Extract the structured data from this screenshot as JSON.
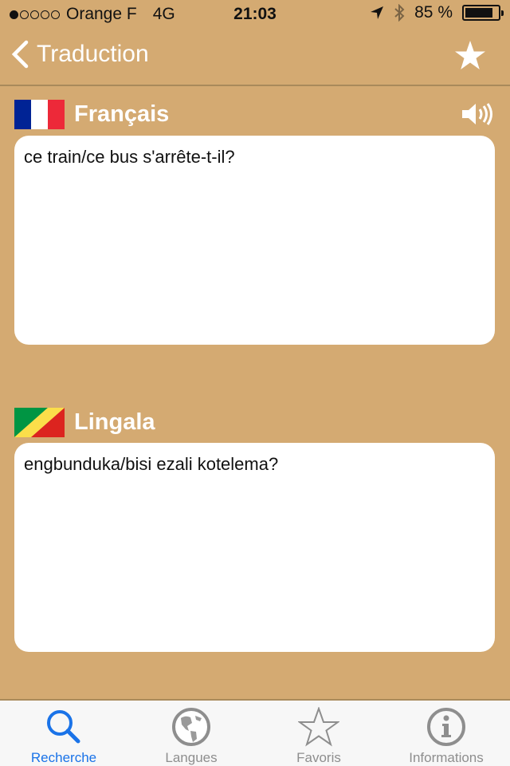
{
  "status_bar": {
    "signal_bars_filled": 1,
    "signal_bars_total": 5,
    "carrier": "Orange F",
    "network": "4G",
    "time": "21:03",
    "battery_percent_label": "85 %",
    "battery_level": 0.85,
    "icons": [
      "location-arrow-icon",
      "bluetooth-icon",
      "battery-icon"
    ]
  },
  "nav": {
    "back_label": "Traduction",
    "favorite_icon": "star-icon"
  },
  "source": {
    "language": "Français",
    "flag": "france-flag",
    "text": "ce train/ce bus s'arrête-t-il?",
    "speaker_icon": "speaker-icon"
  },
  "target": {
    "language": "Lingala",
    "flag": "congo-flag",
    "text": "engbunduka/bisi ezali kotelema?"
  },
  "tabs": [
    {
      "label": "Recherche",
      "icon": "search-icon",
      "active": true
    },
    {
      "label": "Langues",
      "icon": "globe-icon",
      "active": false
    },
    {
      "label": "Favoris",
      "icon": "star-outline-icon",
      "active": false
    },
    {
      "label": "Informations",
      "icon": "info-icon",
      "active": false
    }
  ],
  "colors": {
    "background": "#d4aa72",
    "accent": "#1a73e8",
    "tab_inactive": "#8e8e8e"
  }
}
